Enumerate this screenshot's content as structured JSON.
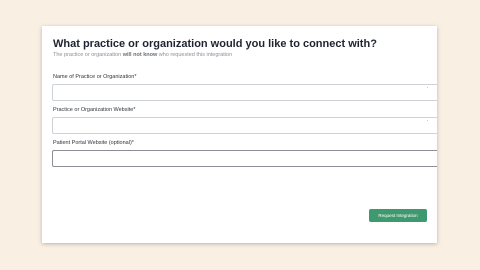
{
  "modal": {
    "title": "What practice or organization would you like to connect with?",
    "subtitle_pre": "The practice or organization ",
    "subtitle_bold": "will not know",
    "subtitle_post": " who requested this integration"
  },
  "form": {
    "fields": [
      {
        "label": "Name of Practice or Organization*",
        "value": ""
      },
      {
        "label": "Practice or Organization Website*",
        "value": ""
      },
      {
        "label": "Patient Portal Website (optional)*",
        "value": ""
      }
    ]
  },
  "actions": {
    "submit_label": "Request Integration",
    "submit_color": "#3e9a6e"
  }
}
